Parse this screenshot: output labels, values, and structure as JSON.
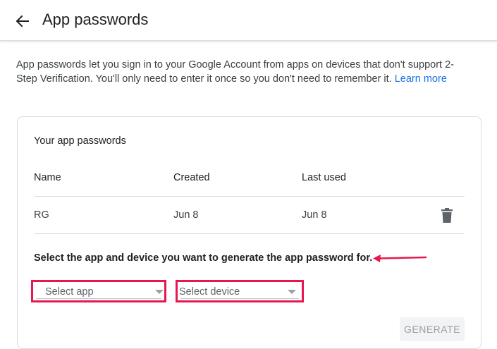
{
  "header": {
    "title": "App passwords",
    "back_icon": "arrow-left-icon"
  },
  "intro": {
    "text": "App passwords let you sign in to your Google Account from apps on devices that don't support 2-Step Verification. You'll only need to enter it once so you don't need to remember it. ",
    "learn_more": "Learn more"
  },
  "card": {
    "title": "Your app passwords",
    "columns": [
      "Name",
      "Created",
      "Last used"
    ],
    "rows": [
      {
        "name": "RG",
        "created": "Jun 8",
        "last_used": "Jun 8",
        "delete_icon": "trash-icon"
      }
    ],
    "select_label": "Select the app and device you want to generate the app password for.",
    "select_app": "Select app",
    "select_device": "Select device",
    "generate": "GENERATE"
  },
  "colors": {
    "accent": "#1a73e8",
    "annotation": "#e8174f",
    "disabled_text": "#9aa0a6"
  }
}
